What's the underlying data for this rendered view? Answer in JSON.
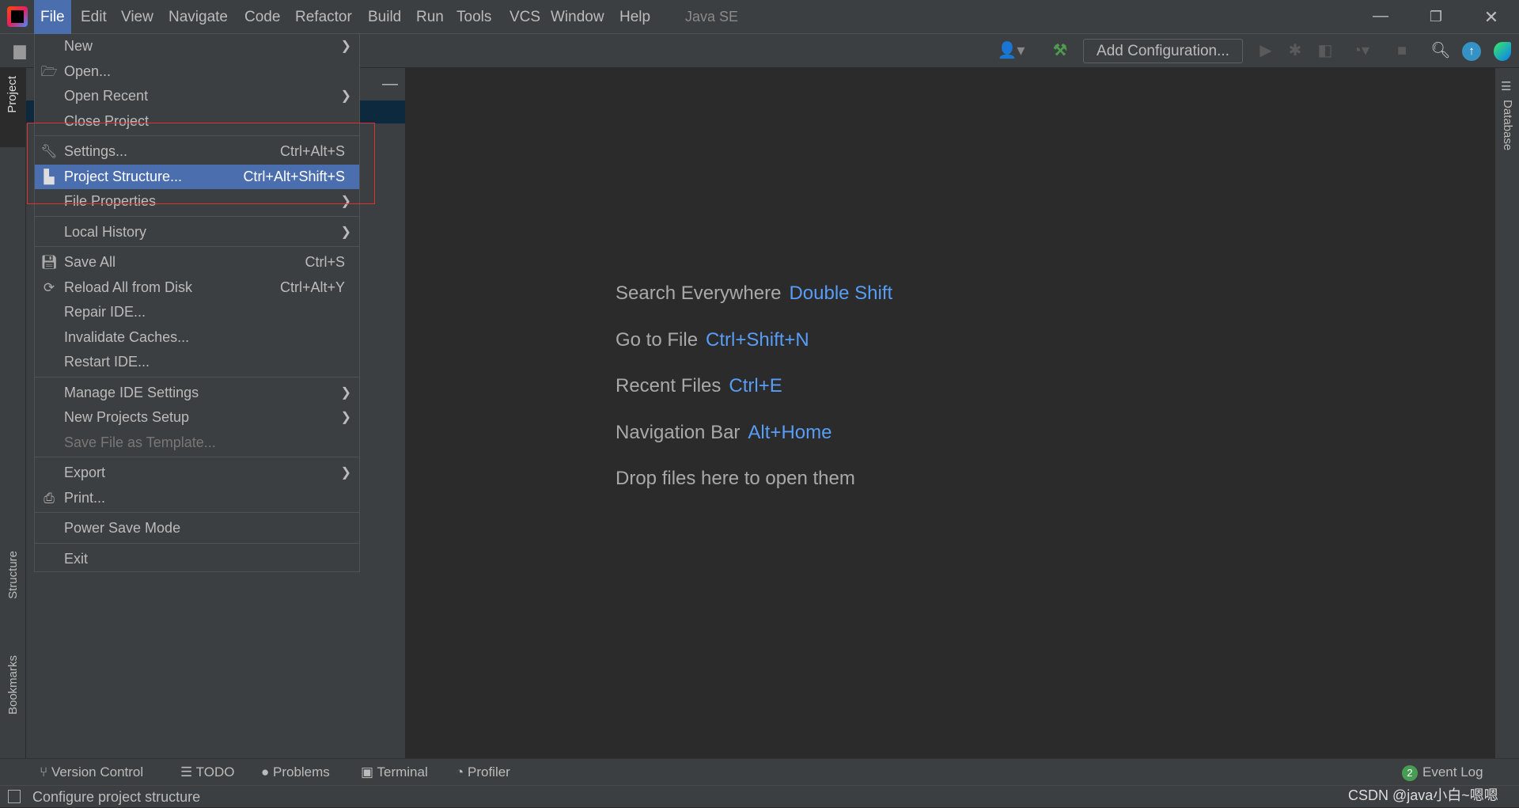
{
  "menubar": {
    "items": [
      "File",
      "Edit",
      "View",
      "Navigate",
      "Code",
      "Refactor",
      "Build",
      "Run",
      "Tools",
      "VCS",
      "Window",
      "Help"
    ],
    "project_name": "Java SE"
  },
  "toolbar": {
    "add_configuration": "Add Configuration..."
  },
  "side": {
    "project": "Project",
    "structure": "Structure",
    "bookmarks": "Bookmarks",
    "database": "Database"
  },
  "file_menu": [
    {
      "label": "New",
      "submenu": true
    },
    {
      "label": "Open...",
      "icon": "folder-open-icon"
    },
    {
      "label": "Open Recent",
      "submenu": true
    },
    {
      "label": "Close Project"
    },
    {
      "sep": true
    },
    {
      "label": "Settings...",
      "shortcut": "Ctrl+Alt+S",
      "icon": "wrench-icon"
    },
    {
      "label": "Project Structure...",
      "shortcut": "Ctrl+Alt+Shift+S",
      "icon": "project-structure-icon",
      "selected": true
    },
    {
      "label": "File Properties",
      "submenu": true
    },
    {
      "sep": true
    },
    {
      "label": "Local History",
      "submenu": true
    },
    {
      "sep": true
    },
    {
      "label": "Save All",
      "shortcut": "Ctrl+S",
      "icon": "save-icon"
    },
    {
      "label": "Reload All from Disk",
      "shortcut": "Ctrl+Alt+Y",
      "icon": "reload-icon"
    },
    {
      "label": "Repair IDE..."
    },
    {
      "label": "Invalidate Caches..."
    },
    {
      "label": "Restart IDE..."
    },
    {
      "sep": true
    },
    {
      "label": "Manage IDE Settings",
      "submenu": true
    },
    {
      "label": "New Projects Setup",
      "submenu": true
    },
    {
      "label": "Save File as Template...",
      "disabled": true
    },
    {
      "sep": true
    },
    {
      "label": "Export",
      "submenu": true
    },
    {
      "label": "Print...",
      "icon": "print-icon"
    },
    {
      "sep": true
    },
    {
      "label": "Power Save Mode"
    },
    {
      "sep": true
    },
    {
      "label": "Exit"
    }
  ],
  "welcome": [
    {
      "text": "Search Everywhere",
      "key": "Double Shift"
    },
    {
      "text": "Go to File",
      "key": "Ctrl+Shift+N"
    },
    {
      "text": "Recent Files",
      "key": "Ctrl+E"
    },
    {
      "text": "Navigation Bar",
      "key": "Alt+Home"
    },
    {
      "text": "Drop files here to open them",
      "key": ""
    }
  ],
  "toolwindows": [
    "Version Control",
    "TODO",
    "Problems",
    "Terminal",
    "Profiler"
  ],
  "event_log": {
    "label": "Event Log",
    "count": "2"
  },
  "status": {
    "text": "Configure project structure",
    "watermark": "CSDN @java小白~嗯嗯"
  },
  "colors": {
    "accent": "#4b6eaf",
    "link": "#589df6",
    "highlight_box": "#e0302f"
  }
}
